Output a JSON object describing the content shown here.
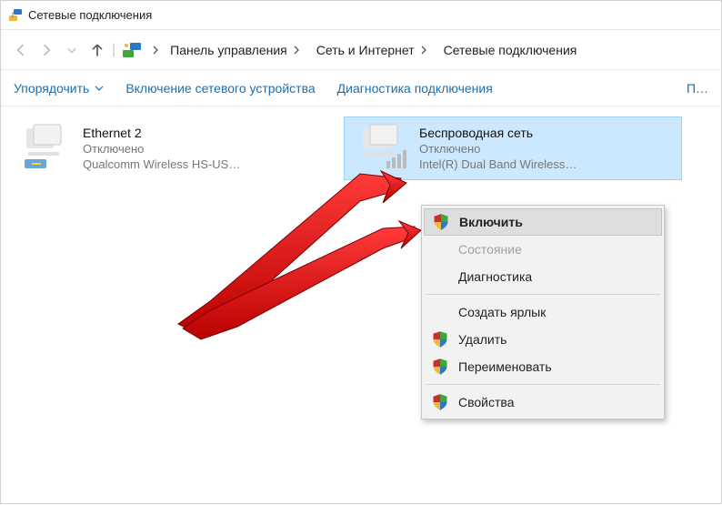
{
  "title": "Сетевые подключения",
  "breadcrumb": {
    "items": [
      "Панель управления",
      "Сеть и Интернет",
      "Сетевые подключения"
    ]
  },
  "toolbar": {
    "organize": "Упорядочить",
    "enable_device": "Включение сетевого устройства",
    "diagnose": "Диагностика подключения",
    "more": "П…"
  },
  "connections": [
    {
      "name": "Ethernet 2",
      "status": "Отключено",
      "device": "Qualcomm Wireless HS-US…"
    },
    {
      "name": "Беспроводная сеть",
      "status": "Отключено",
      "device": "Intel(R) Dual Band Wireless…"
    }
  ],
  "context_menu": {
    "enable": "Включить",
    "status": "Состояние",
    "diagnose": "Диагностика",
    "create_shortcut": "Создать ярлык",
    "delete": "Удалить",
    "rename": "Переименовать",
    "properties": "Свойства"
  }
}
